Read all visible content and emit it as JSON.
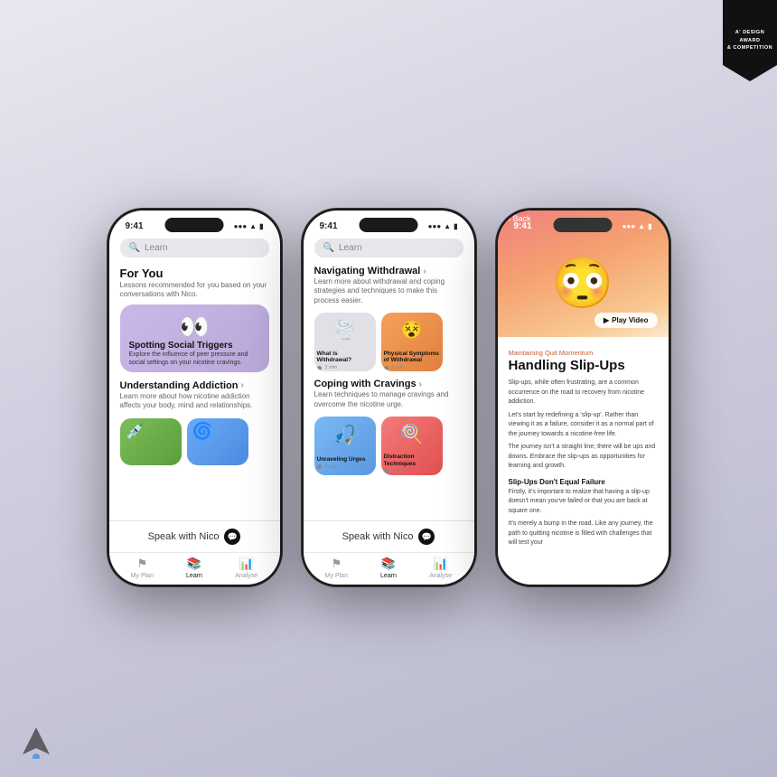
{
  "award": {
    "title": "A' DESIGN\nAWARD\n& COMPETITION"
  },
  "phone1": {
    "time": "9:41",
    "search_placeholder": "Learn",
    "section1_title": "For You",
    "section1_subtitle": "Lessons recommended for you based on your\nconversations with Nico.",
    "feature_card_title": "Spotting Social Triggers",
    "feature_card_subtitle": "Explore the influence of peer pressure and social settings on your nicotine cravings.",
    "section2_title": "Understanding Addiction",
    "section2_subtitle": "Learn more about how nicotine addiction affects your body, mind and relationships.",
    "speak_label": "Speak with Nico",
    "nav_plan": "My Plan",
    "nav_learn": "Learn",
    "nav_analyse": "Analyse"
  },
  "phone2": {
    "time": "9:41",
    "search_placeholder": "Learn",
    "section1_title": "Navigating Withdrawal",
    "section1_subtitle": "Learn more about withdrawal and coping strategies and techniques to make this process easier.",
    "card1_label": "What is Withdrawal?",
    "card1_time": "2 min",
    "card2_label": "Physical Symptoms of Withdrawal",
    "card2_time": "2 min",
    "section2_title": "Coping with Cravings",
    "section2_subtitle": "Learn techniques to manage cravings and overcome the nicotine urge.",
    "card3_label": "Unraveling Urges",
    "card3_time": "2 min",
    "card4_label": "Distraction Techniques",
    "card4_time": "1 min",
    "speak_label": "Speak with Nico",
    "nav_plan": "My Plan",
    "nav_learn": "Learn",
    "nav_analyse": "Analyse"
  },
  "phone3": {
    "time": "9:41",
    "back_label": "Back",
    "category": "Maintaining Quit Momentum",
    "title": "Handling Slip-Ups",
    "play_label": "Play Video",
    "body1": "Slip-ups, while often frustrating, are a common occurrence on the road to recovery from nicotine addiction.",
    "body2": "Let's start by redefining a 'slip-up'. Rather than viewing it as a failure, consider it as a normal part of the journey towards a nicotine-free life.",
    "body3": "The journey isn't a straight line; there will be ups and downs. Embrace the slip-ups as opportunities for learning and growth.",
    "subheading": "Slip-Ups Don't Equal Failure",
    "body4": "Firstly, it's important to realize that having a slip-up doesn't mean you've failed or that you are back at square one.",
    "body5": "It's merely a bump in the road. Like any journey, the path to quitting nicotine is filled with challenges that will test your"
  }
}
